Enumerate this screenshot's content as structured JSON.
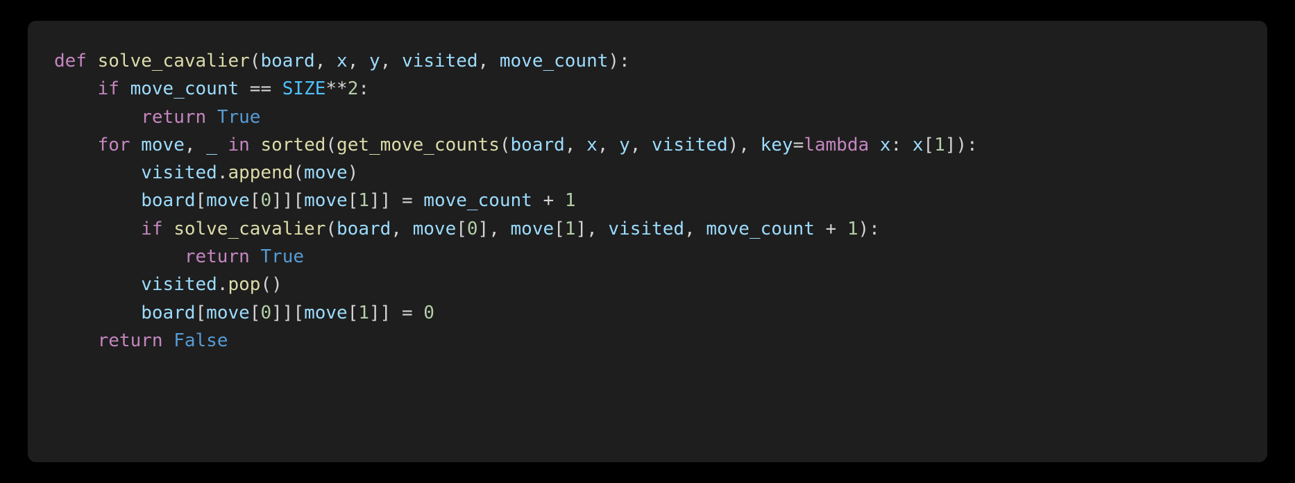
{
  "language": "python",
  "tokens": [
    {
      "cls": "tok-kw",
      "t": "def"
    },
    {
      "cls": "tok-op",
      "t": " "
    },
    {
      "cls": "tok-fn",
      "t": "solve_cavalier"
    },
    {
      "cls": "tok-pun",
      "t": "("
    },
    {
      "cls": "tok-var",
      "t": "board"
    },
    {
      "cls": "tok-pun",
      "t": ", "
    },
    {
      "cls": "tok-var",
      "t": "x"
    },
    {
      "cls": "tok-pun",
      "t": ", "
    },
    {
      "cls": "tok-var",
      "t": "y"
    },
    {
      "cls": "tok-pun",
      "t": ", "
    },
    {
      "cls": "tok-var",
      "t": "visited"
    },
    {
      "cls": "tok-pun",
      "t": ", "
    },
    {
      "cls": "tok-var",
      "t": "move_count"
    },
    {
      "cls": "tok-pun",
      "t": "):"
    },
    {
      "cls": "nl",
      "t": "\n"
    },
    {
      "cls": "tok-op",
      "t": "    "
    },
    {
      "cls": "tok-kw",
      "t": "if"
    },
    {
      "cls": "tok-op",
      "t": " "
    },
    {
      "cls": "tok-var",
      "t": "move_count"
    },
    {
      "cls": "tok-op",
      "t": " == "
    },
    {
      "cls": "tok-const",
      "t": "SIZE"
    },
    {
      "cls": "tok-op",
      "t": "**"
    },
    {
      "cls": "tok-num",
      "t": "2"
    },
    {
      "cls": "tok-pun",
      "t": ":"
    },
    {
      "cls": "nl",
      "t": "\n"
    },
    {
      "cls": "tok-op",
      "t": "        "
    },
    {
      "cls": "tok-kw",
      "t": "return"
    },
    {
      "cls": "tok-op",
      "t": " "
    },
    {
      "cls": "tok-bool",
      "t": "True"
    },
    {
      "cls": "nl",
      "t": "\n"
    },
    {
      "cls": "tok-op",
      "t": "    "
    },
    {
      "cls": "tok-kw",
      "t": "for"
    },
    {
      "cls": "tok-op",
      "t": " "
    },
    {
      "cls": "tok-var",
      "t": "move"
    },
    {
      "cls": "tok-pun",
      "t": ", "
    },
    {
      "cls": "tok-var",
      "t": "_"
    },
    {
      "cls": "tok-op",
      "t": " "
    },
    {
      "cls": "tok-kw",
      "t": "in"
    },
    {
      "cls": "tok-op",
      "t": " "
    },
    {
      "cls": "tok-fn",
      "t": "sorted"
    },
    {
      "cls": "tok-pun",
      "t": "("
    },
    {
      "cls": "tok-fn",
      "t": "get_move_counts"
    },
    {
      "cls": "tok-pun",
      "t": "("
    },
    {
      "cls": "tok-var",
      "t": "board"
    },
    {
      "cls": "tok-pun",
      "t": ", "
    },
    {
      "cls": "tok-var",
      "t": "x"
    },
    {
      "cls": "tok-pun",
      "t": ", "
    },
    {
      "cls": "tok-var",
      "t": "y"
    },
    {
      "cls": "tok-pun",
      "t": ", "
    },
    {
      "cls": "tok-var",
      "t": "visited"
    },
    {
      "cls": "tok-pun",
      "t": "), "
    },
    {
      "cls": "tok-var",
      "t": "key"
    },
    {
      "cls": "tok-op",
      "t": "="
    },
    {
      "cls": "tok-kw",
      "t": "lambda"
    },
    {
      "cls": "tok-op",
      "t": " "
    },
    {
      "cls": "tok-var",
      "t": "x"
    },
    {
      "cls": "tok-pun",
      "t": ": "
    },
    {
      "cls": "tok-var",
      "t": "x"
    },
    {
      "cls": "tok-pun",
      "t": "["
    },
    {
      "cls": "tok-num",
      "t": "1"
    },
    {
      "cls": "tok-pun",
      "t": "]):"
    },
    {
      "cls": "nl",
      "t": "\n"
    },
    {
      "cls": "tok-op",
      "t": "        "
    },
    {
      "cls": "tok-var",
      "t": "visited"
    },
    {
      "cls": "tok-pun",
      "t": "."
    },
    {
      "cls": "tok-fn",
      "t": "append"
    },
    {
      "cls": "tok-pun",
      "t": "("
    },
    {
      "cls": "tok-var",
      "t": "move"
    },
    {
      "cls": "tok-pun",
      "t": ")"
    },
    {
      "cls": "nl",
      "t": "\n"
    },
    {
      "cls": "tok-op",
      "t": "        "
    },
    {
      "cls": "tok-var",
      "t": "board"
    },
    {
      "cls": "tok-pun",
      "t": "["
    },
    {
      "cls": "tok-var",
      "t": "move"
    },
    {
      "cls": "tok-pun",
      "t": "["
    },
    {
      "cls": "tok-num",
      "t": "0"
    },
    {
      "cls": "tok-pun",
      "t": "]]["
    },
    {
      "cls": "tok-var",
      "t": "move"
    },
    {
      "cls": "tok-pun",
      "t": "["
    },
    {
      "cls": "tok-num",
      "t": "1"
    },
    {
      "cls": "tok-pun",
      "t": "]] = "
    },
    {
      "cls": "tok-var",
      "t": "move_count"
    },
    {
      "cls": "tok-op",
      "t": " + "
    },
    {
      "cls": "tok-num",
      "t": "1"
    },
    {
      "cls": "nl",
      "t": "\n"
    },
    {
      "cls": "tok-op",
      "t": "        "
    },
    {
      "cls": "tok-kw",
      "t": "if"
    },
    {
      "cls": "tok-op",
      "t": " "
    },
    {
      "cls": "tok-fn",
      "t": "solve_cavalier"
    },
    {
      "cls": "tok-pun",
      "t": "("
    },
    {
      "cls": "tok-var",
      "t": "board"
    },
    {
      "cls": "tok-pun",
      "t": ", "
    },
    {
      "cls": "tok-var",
      "t": "move"
    },
    {
      "cls": "tok-pun",
      "t": "["
    },
    {
      "cls": "tok-num",
      "t": "0"
    },
    {
      "cls": "tok-pun",
      "t": "], "
    },
    {
      "cls": "tok-var",
      "t": "move"
    },
    {
      "cls": "tok-pun",
      "t": "["
    },
    {
      "cls": "tok-num",
      "t": "1"
    },
    {
      "cls": "tok-pun",
      "t": "], "
    },
    {
      "cls": "tok-var",
      "t": "visited"
    },
    {
      "cls": "tok-pun",
      "t": ", "
    },
    {
      "cls": "tok-var",
      "t": "move_count"
    },
    {
      "cls": "tok-op",
      "t": " + "
    },
    {
      "cls": "tok-num",
      "t": "1"
    },
    {
      "cls": "tok-pun",
      "t": "):"
    },
    {
      "cls": "nl",
      "t": "\n"
    },
    {
      "cls": "tok-op",
      "t": "            "
    },
    {
      "cls": "tok-kw",
      "t": "return"
    },
    {
      "cls": "tok-op",
      "t": " "
    },
    {
      "cls": "tok-bool",
      "t": "True"
    },
    {
      "cls": "nl",
      "t": "\n"
    },
    {
      "cls": "tok-op",
      "t": "        "
    },
    {
      "cls": "tok-var",
      "t": "visited"
    },
    {
      "cls": "tok-pun",
      "t": "."
    },
    {
      "cls": "tok-fn",
      "t": "pop"
    },
    {
      "cls": "tok-pun",
      "t": "()"
    },
    {
      "cls": "nl",
      "t": "\n"
    },
    {
      "cls": "tok-op",
      "t": "        "
    },
    {
      "cls": "tok-var",
      "t": "board"
    },
    {
      "cls": "tok-pun",
      "t": "["
    },
    {
      "cls": "tok-var",
      "t": "move"
    },
    {
      "cls": "tok-pun",
      "t": "["
    },
    {
      "cls": "tok-num",
      "t": "0"
    },
    {
      "cls": "tok-pun",
      "t": "]]["
    },
    {
      "cls": "tok-var",
      "t": "move"
    },
    {
      "cls": "tok-pun",
      "t": "["
    },
    {
      "cls": "tok-num",
      "t": "1"
    },
    {
      "cls": "tok-pun",
      "t": "]] = "
    },
    {
      "cls": "tok-num",
      "t": "0"
    },
    {
      "cls": "nl",
      "t": "\n"
    },
    {
      "cls": "tok-op",
      "t": "    "
    },
    {
      "cls": "tok-kw",
      "t": "return"
    },
    {
      "cls": "tok-op",
      "t": " "
    },
    {
      "cls": "tok-bool",
      "t": "False"
    }
  ]
}
